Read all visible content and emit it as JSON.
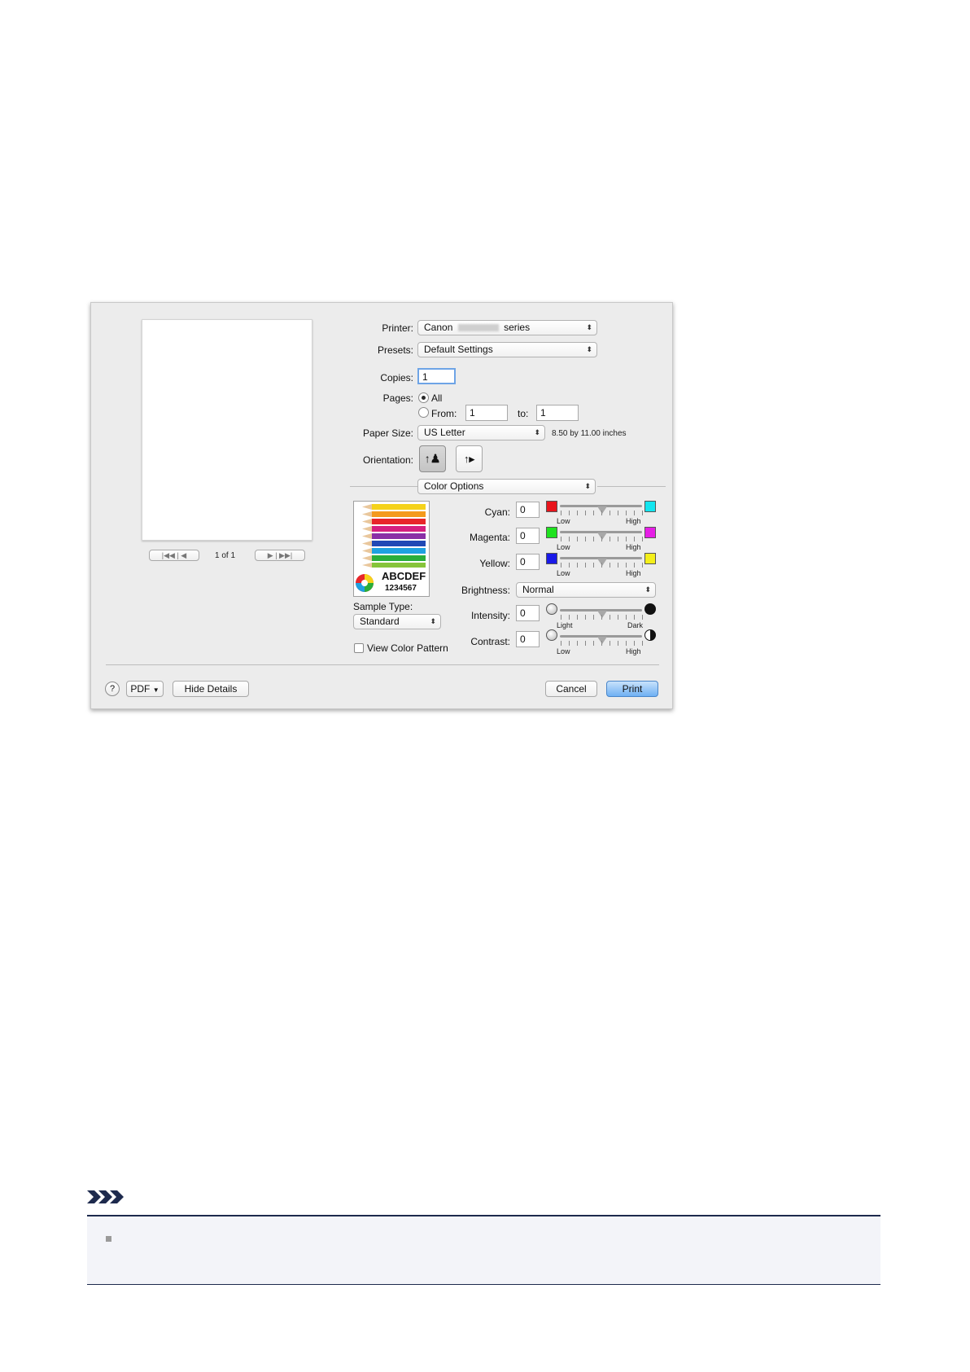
{
  "preview": {
    "page_counter": "1 of 1"
  },
  "printer": {
    "label": "Printer:",
    "value_prefix": "Canon",
    "value_suffix": "series"
  },
  "presets": {
    "label": "Presets:",
    "value": "Default Settings"
  },
  "copies": {
    "label": "Copies:",
    "value": "1"
  },
  "pages": {
    "label": "Pages:",
    "all_label": "All",
    "from_label": "From:",
    "from_value": "1",
    "to_label": "to:",
    "to_value": "1",
    "selected": "All"
  },
  "paper_size": {
    "label": "Paper Size:",
    "value": "US Letter",
    "dimensions": "8.50 by 11.00 inches"
  },
  "orientation": {
    "label": "Orientation:",
    "selected": "portrait"
  },
  "panel": {
    "value": "Color Options"
  },
  "sample": {
    "text_line1": "ABCDEF",
    "text_line2": "1234567",
    "type_label": "Sample Type:",
    "type_value": "Standard",
    "view_pattern_label": "View Color Pattern",
    "view_pattern_checked": false
  },
  "color_adjust": {
    "cyan": {
      "label": "Cyan:",
      "value": "0",
      "low_color": "#e8141b",
      "high_color": "#13e5ef",
      "low_label": "Low",
      "high_label": "High",
      "slider_fraction": 0.5
    },
    "magenta": {
      "label": "Magenta:",
      "value": "0",
      "low_color": "#1fe21f",
      "high_color": "#e61ee6",
      "low_label": "Low",
      "high_label": "High",
      "slider_fraction": 0.5
    },
    "yellow": {
      "label": "Yellow:",
      "value": "0",
      "low_color": "#1a1ae8",
      "high_color": "#f4ef1a",
      "low_label": "Low",
      "high_label": "High",
      "slider_fraction": 0.5
    },
    "brightness": {
      "label": "Brightness:",
      "value": "Normal"
    },
    "intensity": {
      "label": "Intensity:",
      "value": "0",
      "low_label": "Light",
      "high_label": "Dark",
      "slider_fraction": 0.5
    },
    "contrast": {
      "label": "Contrast:",
      "value": "0",
      "low_label": "Low",
      "high_label": "High",
      "slider_fraction": 0.5
    }
  },
  "footer": {
    "help": "?",
    "pdf": "PDF",
    "hide_details": "Hide Details",
    "cancel": "Cancel",
    "print": "Print"
  }
}
